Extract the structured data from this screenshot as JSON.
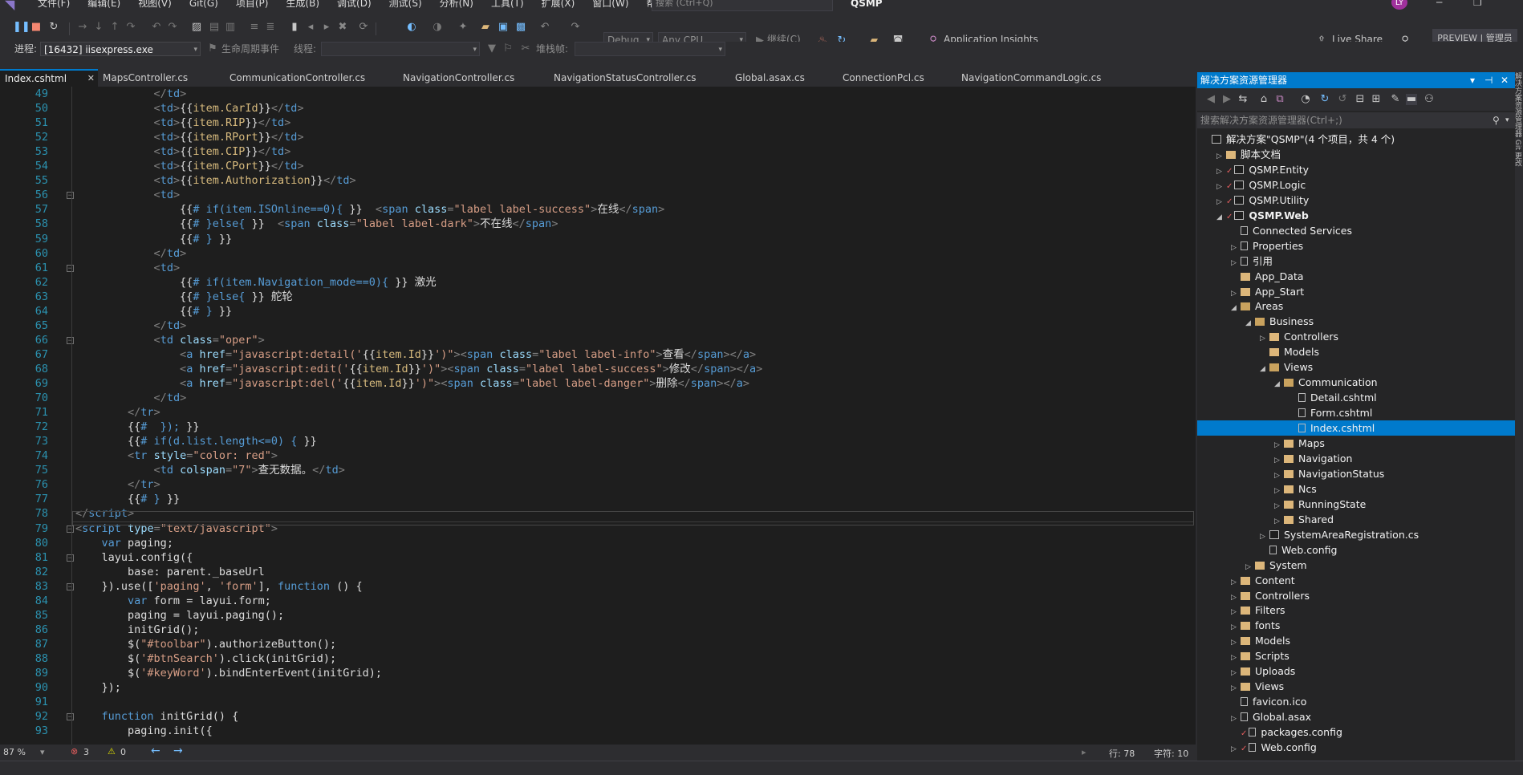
{
  "menubar": {
    "logo": "◥",
    "menus": [
      "文件(F)",
      "编辑(E)",
      "视图(V)",
      "Git(G)",
      "项目(P)",
      "生成(B)",
      "调试(D)",
      "测试(S)",
      "分析(N)",
      "工具(T)",
      "扩展(X)",
      "窗口(W)",
      "帮助(H)"
    ],
    "search_placeholder": "搜索 (Ctrl+Q)",
    "project_name": "QSMP",
    "avatar_initials": "LY"
  },
  "toolbar": {
    "config": "Debug",
    "platform": "Any CPU",
    "continue_label": "继续(C)",
    "insights_label": "Application Insights",
    "live_share_label": "Live Share",
    "preview_label": "PREVIEW | 管理员"
  },
  "debugbar": {
    "process_label": "进程:",
    "process_value": "[16432] iisexpress.exe",
    "lifecycle_label": "生命周期事件",
    "thread_label": "线程:",
    "stackframe_label": "堆栈帧:"
  },
  "tabs": [
    {
      "label": "Index.cshtml",
      "active": true
    },
    {
      "label": "MapsController.cs"
    },
    {
      "label": "CommunicationController.cs"
    },
    {
      "label": "NavigationController.cs"
    },
    {
      "label": "NavigationStatusController.cs"
    },
    {
      "label": "Global.asax.cs"
    },
    {
      "label": "ConnectionPcl.cs"
    },
    {
      "label": "NavigationCommandLogic.cs"
    }
  ],
  "editor": {
    "lines": [
      {
        "n": "49",
        "html": "            <span class='t'>&lt;/</span><span class='tn'>td</span><span class='t'>&gt;</span>"
      },
      {
        "n": "50",
        "html": "            <span class='t'>&lt;</span><span class='tn'>td</span><span class='t'>&gt;</span><span class='tx'>{{</span><span class='tp'>item.CarId</span><span class='tx'>}}</span><span class='t'>&lt;/</span><span class='tn'>td</span><span class='t'>&gt;</span>"
      },
      {
        "n": "51",
        "html": "            <span class='t'>&lt;</span><span class='tn'>td</span><span class='t'>&gt;</span><span class='tx'>{{</span><span class='tp'>item.RIP</span><span class='tx'>}}</span><span class='t'>&lt;/</span><span class='tn'>td</span><span class='t'>&gt;</span>"
      },
      {
        "n": "52",
        "html": "            <span class='t'>&lt;</span><span class='tn'>td</span><span class='t'>&gt;</span><span class='tx'>{{</span><span class='tp'>item.RPort</span><span class='tx'>}}</span><span class='t'>&lt;/</span><span class='tn'>td</span><span class='t'>&gt;</span>"
      },
      {
        "n": "53",
        "html": "            <span class='t'>&lt;</span><span class='tn'>td</span><span class='t'>&gt;</span><span class='tx'>{{</span><span class='tp'>item.CIP</span><span class='tx'>}}</span><span class='t'>&lt;/</span><span class='tn'>td</span><span class='t'>&gt;</span>"
      },
      {
        "n": "54",
        "html": "            <span class='t'>&lt;</span><span class='tn'>td</span><span class='t'>&gt;</span><span class='tx'>{{</span><span class='tp'>item.CPort</span><span class='tx'>}}</span><span class='t'>&lt;/</span><span class='tn'>td</span><span class='t'>&gt;</span>"
      },
      {
        "n": "55",
        "html": "            <span class='t'>&lt;</span><span class='tn'>td</span><span class='t'>&gt;</span><span class='tx'>{{</span><span class='tp'>item.Authorization</span><span class='tx'>}}</span><span class='t'>&lt;/</span><span class='tn'>td</span><span class='t'>&gt;</span>"
      },
      {
        "n": "56",
        "html": "            <span class='t'>&lt;</span><span class='tn'>td</span><span class='t'>&gt;</span>"
      },
      {
        "n": "57",
        "html": "                <span class='tx'>{{</span><span class='kw'># if(item.ISOnline==0){ </span><span class='tx'>}}</span>  <span class='t'>&lt;</span><span class='tn'>span</span> <span class='an'>class</span><span class='t'>=</span><span class='av'>\"label label-success\"</span><span class='t'>&gt;</span><span class='tx'>在线</span><span class='t'>&lt;/</span><span class='tn'>span</span><span class='t'>&gt;</span>"
      },
      {
        "n": "58",
        "html": "                <span class='tx'>{{</span><span class='kw'># }else{ </span><span class='tx'>}}</span>  <span class='t'>&lt;</span><span class='tn'>span</span> <span class='an'>class</span><span class='t'>=</span><span class='av'>\"label label-dark\"</span><span class='t'>&gt;</span><span class='tx'>不在线</span><span class='t'>&lt;/</span><span class='tn'>span</span><span class='t'>&gt;</span>"
      },
      {
        "n": "59",
        "html": "                <span class='tx'>{{</span><span class='kw'># } </span><span class='tx'>}}</span>"
      },
      {
        "n": "60",
        "html": "            <span class='t'>&lt;/</span><span class='tn'>td</span><span class='t'>&gt;</span>"
      },
      {
        "n": "61",
        "html": "            <span class='t'>&lt;</span><span class='tn'>td</span><span class='t'>&gt;</span>"
      },
      {
        "n": "62",
        "html": "                <span class='tx'>{{</span><span class='kw'># if(item.Navigation_mode==0){ </span><span class='tx'>}} 激光</span>"
      },
      {
        "n": "63",
        "html": "                <span class='tx'>{{</span><span class='kw'># }else{ </span><span class='tx'>}} 舵轮</span>"
      },
      {
        "n": "64",
        "html": "                <span class='tx'>{{</span><span class='kw'># } </span><span class='tx'>}}</span>"
      },
      {
        "n": "65",
        "html": "            <span class='t'>&lt;/</span><span class='tn'>td</span><span class='t'>&gt;</span>"
      },
      {
        "n": "66",
        "html": "            <span class='t'>&lt;</span><span class='tn'>td</span> <span class='an'>class</span><span class='t'>=</span><span class='av'>\"oper\"</span><span class='t'>&gt;</span>"
      },
      {
        "n": "67",
        "html": "                <span class='t'>&lt;</span><span class='tn'>a</span> <span class='an'>href</span><span class='t'>=</span><span class='av'>\"javascript:detail('</span><span class='tx'>{{</span><span class='tp'>item.Id</span><span class='tx'>}}</span><span class='av'>')\"</span><span class='t'>&gt;&lt;</span><span class='tn'>span</span> <span class='an'>class</span><span class='t'>=</span><span class='av'>\"label label-info\"</span><span class='t'>&gt;</span><span class='tx'>查看</span><span class='t'>&lt;/</span><span class='tn'>span</span><span class='t'>&gt;&lt;/</span><span class='tn'>a</span><span class='t'>&gt;</span>"
      },
      {
        "n": "68",
        "html": "                <span class='t'>&lt;</span><span class='tn'>a</span> <span class='an'>href</span><span class='t'>=</span><span class='av'>\"javascript:edit('</span><span class='tx'>{{</span><span class='tp'>item.Id</span><span class='tx'>}}</span><span class='av'>')\"</span><span class='t'>&gt;&lt;</span><span class='tn'>span</span> <span class='an'>class</span><span class='t'>=</span><span class='av'>\"label label-success\"</span><span class='t'>&gt;</span><span class='tx'>修改</span><span class='t'>&lt;/</span><span class='tn'>span</span><span class='t'>&gt;&lt;/</span><span class='tn'>a</span><span class='t'>&gt;</span>"
      },
      {
        "n": "69",
        "html": "                <span class='t'>&lt;</span><span class='tn'>a</span> <span class='an'>href</span><span class='t'>=</span><span class='av'>\"javascript:del('</span><span class='tx'>{{</span><span class='tp'>item.Id</span><span class='tx'>}}</span><span class='av'>')\"</span><span class='t'>&gt;&lt;</span><span class='tn'>span</span> <span class='an'>class</span><span class='t'>=</span><span class='av'>\"label label-danger\"</span><span class='t'>&gt;</span><span class='tx'>删除</span><span class='t'>&lt;/</span><span class='tn'>span</span><span class='t'>&gt;&lt;/</span><span class='tn'>a</span><span class='t'>&gt;</span>"
      },
      {
        "n": "70",
        "html": "            <span class='t'>&lt;/</span><span class='tn'>td</span><span class='t'>&gt;</span>"
      },
      {
        "n": "71",
        "html": "        <span class='t'>&lt;/</span><span class='tn'>tr</span><span class='t'>&gt;</span>"
      },
      {
        "n": "72",
        "html": "        <span class='tx'>{{</span><span class='kw'>#  }); </span><span class='tx'>}}</span>"
      },
      {
        "n": "73",
        "html": "        <span class='tx'>{{</span><span class='kw'># if(d.list.length&lt;=0) { </span><span class='tx'>}}</span>"
      },
      {
        "n": "74",
        "html": "        <span class='t'>&lt;</span><span class='tn'>tr</span> <span class='an'>style</span><span class='t'>=</span><span class='av'>\"color: red\"</span><span class='t'>&gt;</span>"
      },
      {
        "n": "75",
        "html": "            <span class='t'>&lt;</span><span class='tn'>td</span> <span class='an'>colspan</span><span class='t'>=</span><span class='av'>\"7\"</span><span class='t'>&gt;</span><span class='tx'>查无数据。</span><span class='t'>&lt;/</span><span class='tn'>td</span><span class='t'>&gt;</span>"
      },
      {
        "n": "76",
        "html": "        <span class='t'>&lt;/</span><span class='tn'>tr</span><span class='t'>&gt;</span>"
      },
      {
        "n": "77",
        "html": "        <span class='tx'>{{</span><span class='kw'># } </span><span class='tx'>}}</span>"
      },
      {
        "n": "78",
        "html": "<span class='t'>&lt;/</span><span class='tn'>script</span><span class='t'>&gt;</span>"
      },
      {
        "n": "79",
        "html": "<span class='t'>&lt;</span><span class='tn'>script</span> <span class='an'>type</span><span class='t'>=</span><span class='av'>\"text/javascript\"</span><span class='t'>&gt;</span>"
      },
      {
        "n": "80",
        "html": "    <span class='kw'>var</span> <span class='rp'>paging;</span>"
      },
      {
        "n": "81",
        "html": "    <span class='rp'>layui.config({</span>"
      },
      {
        "n": "82",
        "html": "        <span class='rp'>base: parent._baseUrl</span>"
      },
      {
        "n": "83",
        "html": "    <span class='rp'>}).use([</span><span class='st'>'paging'</span><span class='rp'>, </span><span class='st'>'form'</span><span class='rp'>], </span><span class='kw'>function</span><span class='rp'> () {</span>"
      },
      {
        "n": "84",
        "html": "        <span class='kw'>var</span><span class='rp'> form = layui.form;</span>"
      },
      {
        "n": "85",
        "html": "        <span class='rp'>paging = layui.paging();</span>"
      },
      {
        "n": "86",
        "html": "        <span class='rp'>initGrid();</span>"
      },
      {
        "n": "87",
        "html": "        <span class='rp'>$(</span><span class='st'>\"#toolbar\"</span><span class='rp'>).authorizeButton();</span>"
      },
      {
        "n": "88",
        "html": "        <span class='rp'>$(</span><span class='st'>'#btnSearch'</span><span class='rp'>).click(initGrid);</span>"
      },
      {
        "n": "89",
        "html": "        <span class='rp'>$(</span><span class='st'>'#keyWord'</span><span class='rp'>).bindEnterEvent(initGrid);</span>"
      },
      {
        "n": "90",
        "html": "    <span class='rp'>});</span>"
      },
      {
        "n": "91",
        "html": ""
      },
      {
        "n": "92",
        "html": "    <span class='kw'>function</span><span class='rp'> initGrid() {</span>"
      },
      {
        "n": "93",
        "html": "        <span class='rp'>paging.init({</span>"
      }
    ]
  },
  "editor_status": {
    "zoom": "87 %",
    "errors": "3",
    "warnings": "0",
    "line": "行: 78",
    "char": "字符: 10"
  },
  "solution_explorer": {
    "title": "解决方案资源管理器",
    "search_placeholder": "搜索解决方案资源管理器(Ctrl+;)",
    "nodes": [
      {
        "label": "解决方案\"QSMP\"(4 个项目，共 4 个)",
        "depth": 0,
        "caret": "",
        "icon": "proj"
      },
      {
        "label": "脚本文档",
        "depth": 1,
        "caret": "▷",
        "icon": "folder"
      },
      {
        "label": "QSMP.Entity",
        "depth": 1,
        "caret": "▷",
        "icon": "cs",
        "chk": true
      },
      {
        "label": "QSMP.Logic",
        "depth": 1,
        "caret": "▷",
        "icon": "cs",
        "chk": true
      },
      {
        "label": "QSMP.Utility",
        "depth": 1,
        "caret": "▷",
        "icon": "cs",
        "chk": true
      },
      {
        "label": "QSMP.Web",
        "depth": 1,
        "caret": "◢",
        "icon": "proj",
        "chk": true,
        "bold": true
      },
      {
        "label": "Connected Services",
        "depth": 2,
        "caret": "",
        "icon": "file"
      },
      {
        "label": "Properties",
        "depth": 2,
        "caret": "▷",
        "icon": "file"
      },
      {
        "label": "引用",
        "depth": 2,
        "caret": "▷",
        "icon": "file"
      },
      {
        "label": "App_Data",
        "depth": 2,
        "caret": "",
        "icon": "folder"
      },
      {
        "label": "App_Start",
        "depth": 2,
        "caret": "▷",
        "icon": "folder"
      },
      {
        "label": "Areas",
        "depth": 2,
        "caret": "◢",
        "icon": "open"
      },
      {
        "label": "Business",
        "depth": 3,
        "caret": "◢",
        "icon": "open"
      },
      {
        "label": "Controllers",
        "depth": 4,
        "caret": "▷",
        "icon": "folder"
      },
      {
        "label": "Models",
        "depth": 4,
        "caret": "",
        "icon": "folder"
      },
      {
        "label": "Views",
        "depth": 4,
        "caret": "◢",
        "icon": "open"
      },
      {
        "label": "Communication",
        "depth": 5,
        "caret": "◢",
        "icon": "open"
      },
      {
        "label": "Detail.cshtml",
        "depth": 6,
        "caret": "",
        "icon": "file"
      },
      {
        "label": "Form.cshtml",
        "depth": 6,
        "caret": "",
        "icon": "file"
      },
      {
        "label": "Index.cshtml",
        "depth": 6,
        "caret": "",
        "icon": "file",
        "selected": true
      },
      {
        "label": "Maps",
        "depth": 5,
        "caret": "▷",
        "icon": "folder"
      },
      {
        "label": "Navigation",
        "depth": 5,
        "caret": "▷",
        "icon": "folder"
      },
      {
        "label": "NavigationStatus",
        "depth": 5,
        "caret": "▷",
        "icon": "folder"
      },
      {
        "label": "Ncs",
        "depth": 5,
        "caret": "▷",
        "icon": "folder"
      },
      {
        "label": "RunningState",
        "depth": 5,
        "caret": "▷",
        "icon": "folder"
      },
      {
        "label": "Shared",
        "depth": 5,
        "caret": "▷",
        "icon": "folder"
      },
      {
        "label": "SystemAreaRegistration.cs",
        "depth": 4,
        "caret": "▷",
        "icon": "cs"
      },
      {
        "label": "Web.config",
        "depth": 4,
        "caret": "",
        "icon": "file"
      },
      {
        "label": "System",
        "depth": 3,
        "caret": "▷",
        "icon": "folder"
      },
      {
        "label": "Content",
        "depth": 2,
        "caret": "▷",
        "icon": "folder"
      },
      {
        "label": "Controllers",
        "depth": 2,
        "caret": "▷",
        "icon": "folder"
      },
      {
        "label": "Filters",
        "depth": 2,
        "caret": "▷",
        "icon": "folder"
      },
      {
        "label": "fonts",
        "depth": 2,
        "caret": "▷",
        "icon": "folder"
      },
      {
        "label": "Models",
        "depth": 2,
        "caret": "▷",
        "icon": "folder"
      },
      {
        "label": "Scripts",
        "depth": 2,
        "caret": "▷",
        "icon": "folder"
      },
      {
        "label": "Uploads",
        "depth": 2,
        "caret": "▷",
        "icon": "folder"
      },
      {
        "label": "Views",
        "depth": 2,
        "caret": "▷",
        "icon": "folder"
      },
      {
        "label": "favicon.ico",
        "depth": 2,
        "caret": "",
        "icon": "file"
      },
      {
        "label": "Global.asax",
        "depth": 2,
        "caret": "▷",
        "icon": "file"
      },
      {
        "label": "packages.config",
        "depth": 2,
        "caret": "",
        "icon": "file",
        "chk": true
      },
      {
        "label": "Web.config",
        "depth": 2,
        "caret": "▷",
        "icon": "file",
        "chk": true
      }
    ]
  },
  "side_tabs": "解决方案资源管理器  Git 更改"
}
